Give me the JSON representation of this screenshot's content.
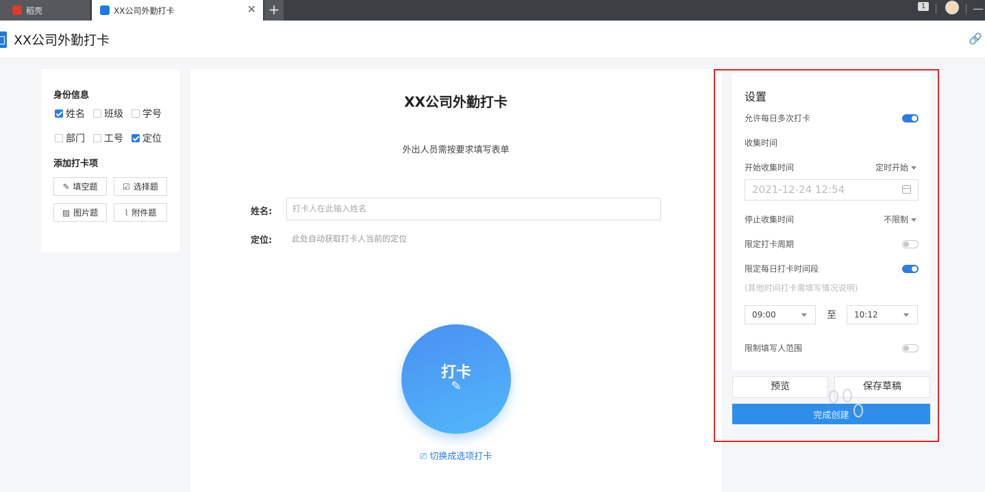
{
  "tabs": [
    {
      "label": "稻壳",
      "active": false
    },
    {
      "label": "XX公司外勤打卡",
      "active": true
    }
  ],
  "tabbar": {
    "new_tab": "+",
    "close": "✕",
    "badge": "1"
  },
  "header": {
    "title": "XX公司外勤打卡",
    "link_icon": "🔗"
  },
  "left_panel": {
    "identity_title": "身份信息",
    "identity_items": [
      {
        "label": "姓名",
        "checked": true
      },
      {
        "label": "班级",
        "checked": false
      },
      {
        "label": "学号",
        "checked": false
      },
      {
        "label": "部门",
        "checked": false
      },
      {
        "label": "工号",
        "checked": false
      },
      {
        "label": "定位",
        "checked": true
      }
    ],
    "add_title": "添加打卡项",
    "add_buttons": [
      {
        "label": "填空题",
        "icon": "pencil-icon"
      },
      {
        "label": "选择题",
        "icon": "checkbox-icon"
      },
      {
        "label": "图片题",
        "icon": "image-icon"
      },
      {
        "label": "附件题",
        "icon": "paperclip-icon"
      }
    ]
  },
  "form": {
    "title": "XX公司外勤打卡",
    "subtitle": "外出人员需按要求填写表单",
    "name_label": "姓名:",
    "name_placeholder": "打卡人在此输入姓名",
    "location_label": "定位:",
    "location_hint": "此处自动获取打卡人当前的定位",
    "punch_label": "打卡",
    "switch_link": "切换成选项打卡"
  },
  "settings": {
    "title": "设置",
    "allow_multiple": {
      "label": "允许每日多次打卡",
      "on": true
    },
    "collect_time": "收集时间",
    "start_label": "开始收集时间",
    "start_mode": "定时开始",
    "start_value": "2021-12-24 12:54",
    "stop_label": "停止收集时间",
    "stop_mode": "不限制",
    "limit_period": {
      "label": "限定打卡周期",
      "on": false
    },
    "limit_daily": {
      "label": "限定每日打卡时间段",
      "on": true
    },
    "daily_hint": "(其他时间打卡需填写情况说明)",
    "time_from": "09:00",
    "time_to_label": "至",
    "time_to": "10:12",
    "limit_range": {
      "label": "限制填写人范围",
      "on": false
    },
    "preview": "预览",
    "save_draft": "保存草稿",
    "create": "完成创建"
  },
  "colors": {
    "accent": "#2c7be5",
    "highlight": "#e0242a"
  }
}
